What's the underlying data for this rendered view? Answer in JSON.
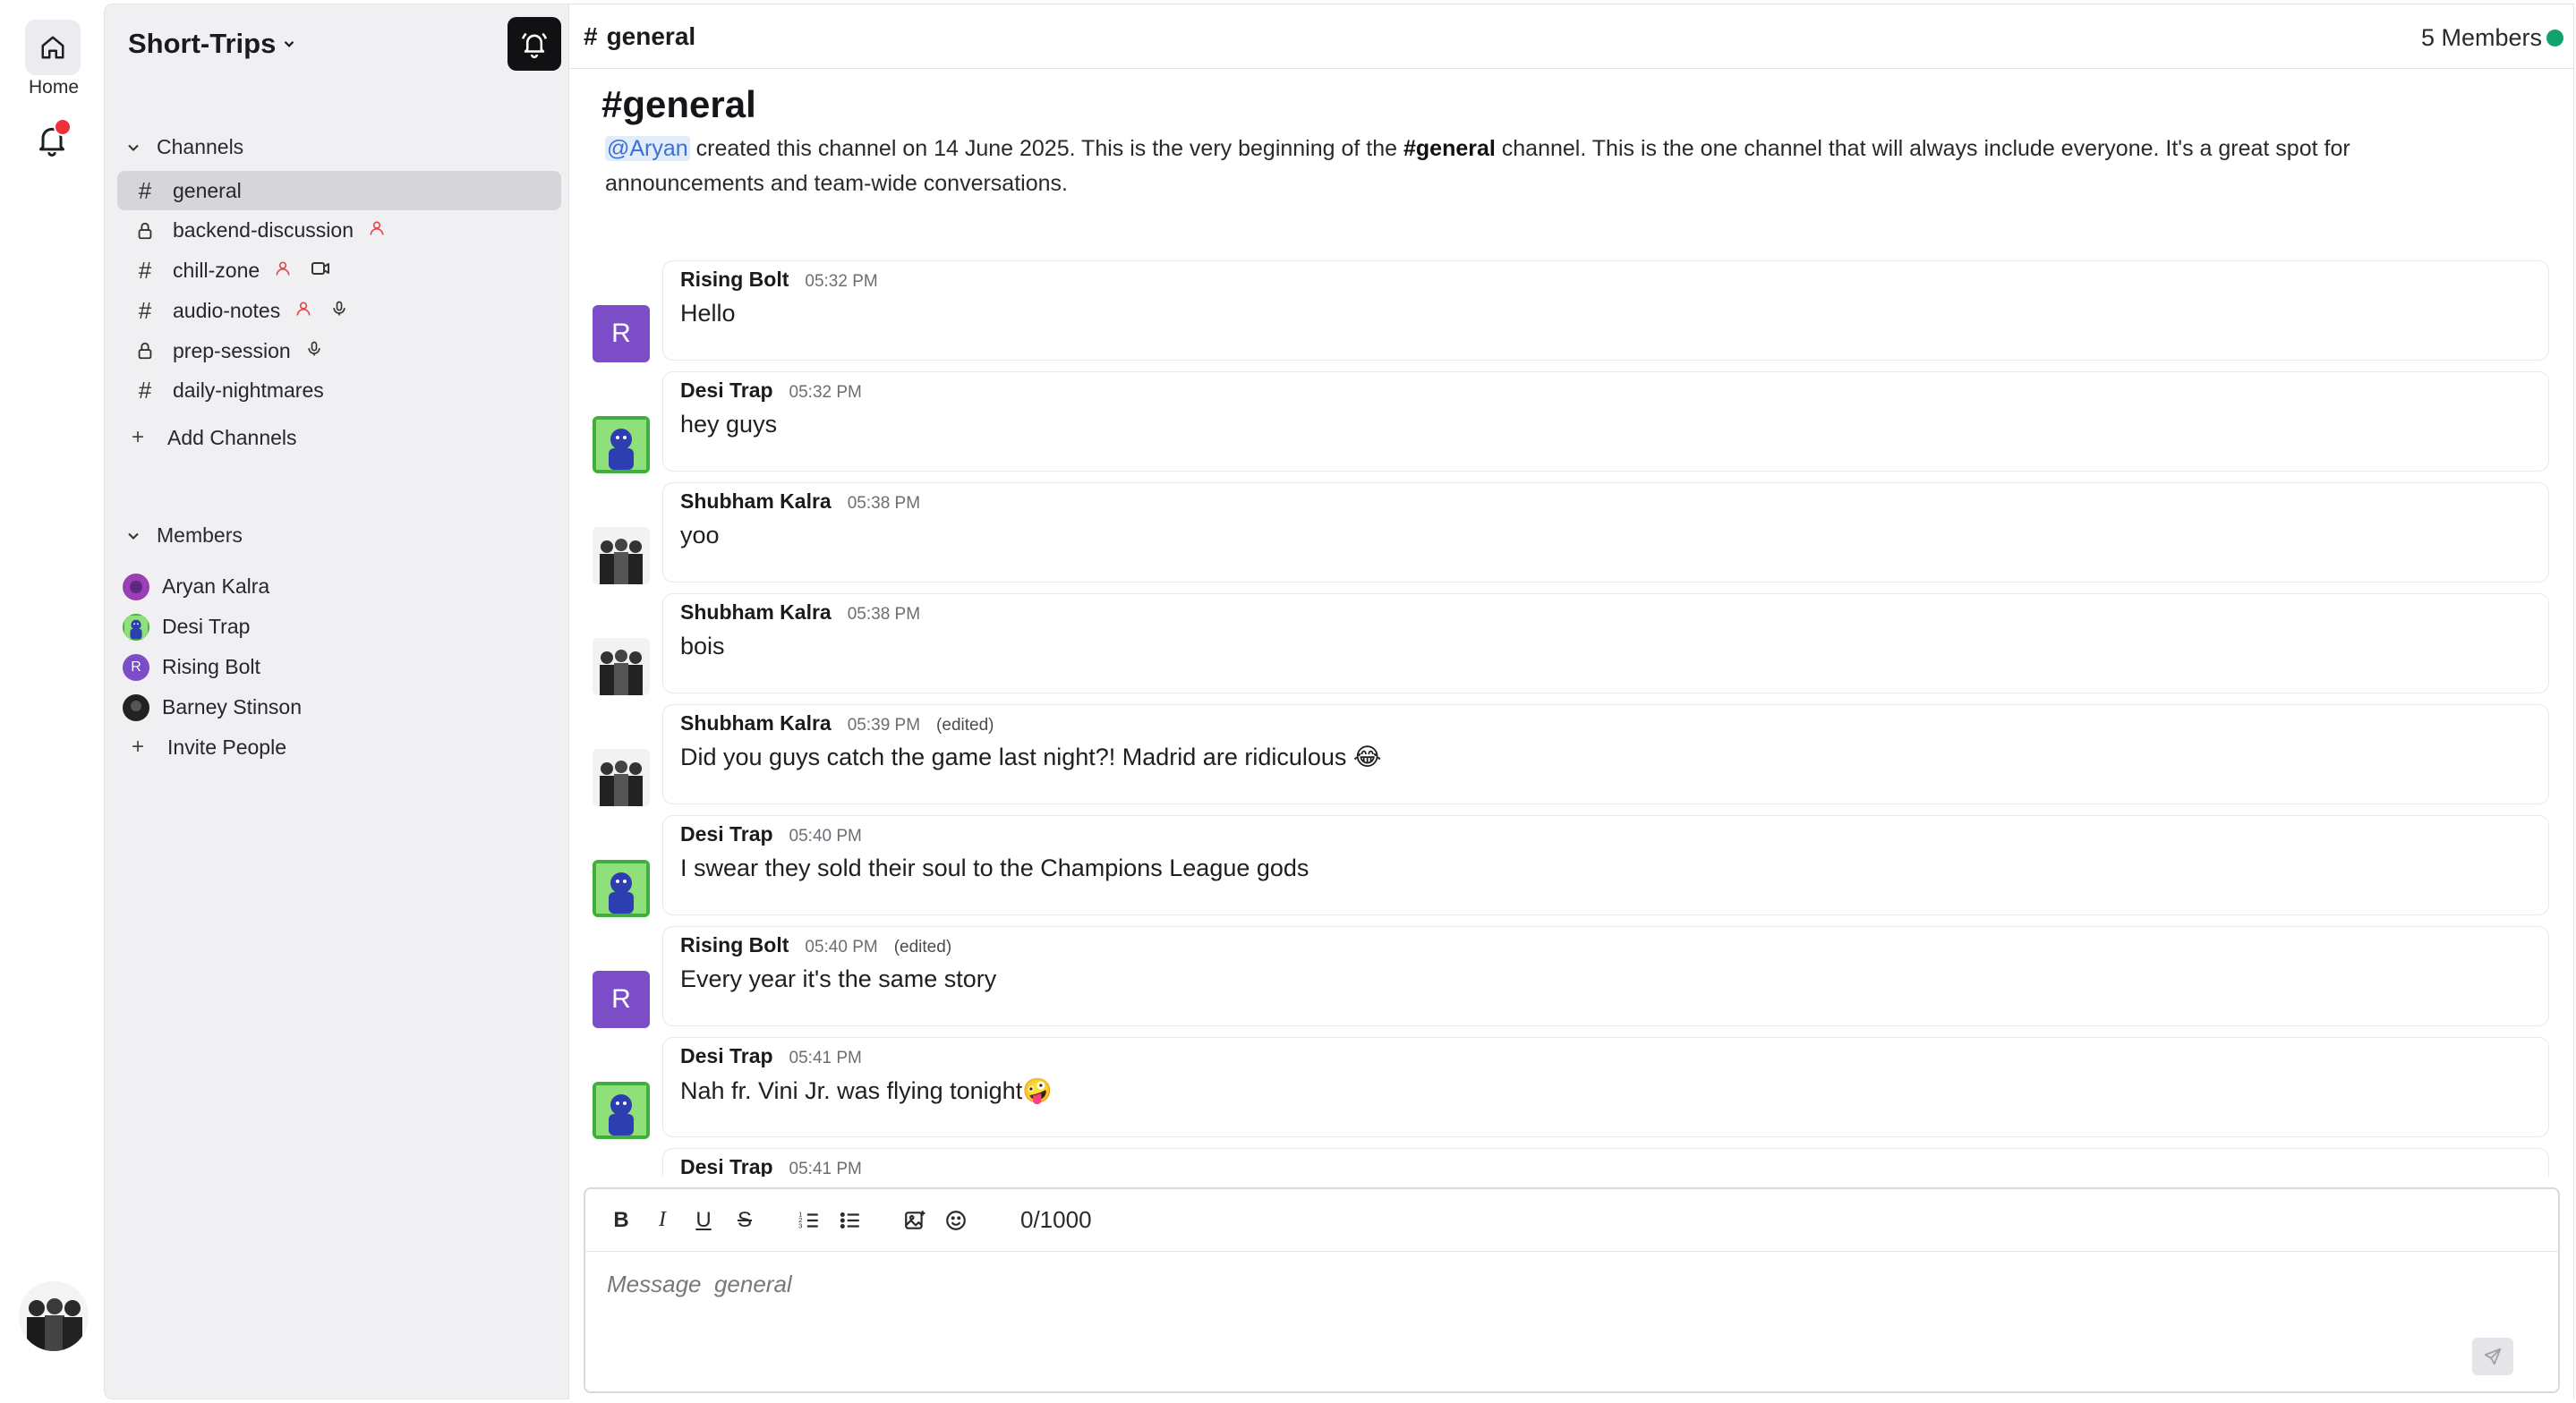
{
  "rail": {
    "home_label": "Home",
    "icons": [
      "home-icon",
      "bell-icon",
      "user-avatar"
    ]
  },
  "sidebar": {
    "workspace_name": "Short-Trips",
    "channels_header": "Channels",
    "channels": [
      {
        "name": "general",
        "icon": "hash",
        "active": true,
        "extras": []
      },
      {
        "name": "backend-discussion",
        "icon": "lock",
        "active": false,
        "extras": [
          "person"
        ]
      },
      {
        "name": "chill-zone",
        "icon": "hash",
        "active": false,
        "extras": [
          "person",
          "video"
        ]
      },
      {
        "name": "audio-notes",
        "icon": "hash",
        "active": false,
        "extras": [
          "person",
          "mic"
        ]
      },
      {
        "name": "prep-session",
        "icon": "lock",
        "active": false,
        "extras": [
          "mic"
        ]
      },
      {
        "name": "daily-nightmares",
        "icon": "hash",
        "active": false,
        "extras": []
      }
    ],
    "add_channels_label": "Add Channels",
    "members_header": "Members",
    "members": [
      {
        "name": "Aryan Kalra",
        "avatar": "purple"
      },
      {
        "name": "Desi Trap",
        "avatar": "green"
      },
      {
        "name": "Rising Bolt",
        "avatar": "R"
      },
      {
        "name": "Barney Stinson",
        "avatar": "dark"
      }
    ],
    "invite_label": "Invite People"
  },
  "header": {
    "channel": "general",
    "members_count": "5 Members"
  },
  "intro": {
    "title": "general",
    "mention": "@Aryan",
    "text_1": " created this channel on 14 June 2025. This is the very beginning of the ",
    "channel_bold": "#general",
    "text_2": " channel. This is the one channel that will always include everyone. It's a great spot for announcements and team-wide conversations."
  },
  "messages": [
    {
      "author": "Rising Bolt",
      "time": "05:32 PM",
      "edited": "",
      "text": "Hello",
      "avatar": "R"
    },
    {
      "author": "Desi Trap",
      "time": "05:32 PM",
      "edited": "",
      "text": "hey guys",
      "avatar": "green"
    },
    {
      "author": "Shubham Kalra",
      "time": "05:38 PM",
      "edited": "",
      "text": "yoo",
      "avatar": "photo"
    },
    {
      "author": "Shubham Kalra",
      "time": "05:38 PM",
      "edited": "",
      "text": "bois",
      "avatar": "photo"
    },
    {
      "author": "Shubham Kalra",
      "time": "05:39 PM",
      "edited": "(edited)",
      "text": "Did you guys catch the game last night?! Madrid are ridiculous 😂",
      "avatar": "photo"
    },
    {
      "author": "Desi Trap",
      "time": "05:40 PM",
      "edited": "",
      "text": "I swear they sold their soul to the Champions League gods",
      "avatar": "green"
    },
    {
      "author": "Rising Bolt",
      "time": "05:40 PM",
      "edited": "(edited)",
      "text": "Every year it's the same story",
      "avatar": "R"
    },
    {
      "author": "Desi Trap",
      "time": "05:41 PM",
      "edited": "",
      "text": "Nah fr. Vini Jr. was flying tonight🤪",
      "avatar": "green"
    },
    {
      "author": "Desi Trap",
      "time": "05:41 PM",
      "edited": "",
      "text": "",
      "avatar": "green"
    }
  ],
  "composer": {
    "char_count": "0/1000",
    "placeholder": "Message  general",
    "value": ""
  },
  "colors": {
    "active_channel_bg": "#d6d6da",
    "online": "#10a36b",
    "notification": "#ef2f3a",
    "rising_bolt_avatar": "#7b4dc6",
    "member_icon": "#e0474c"
  }
}
